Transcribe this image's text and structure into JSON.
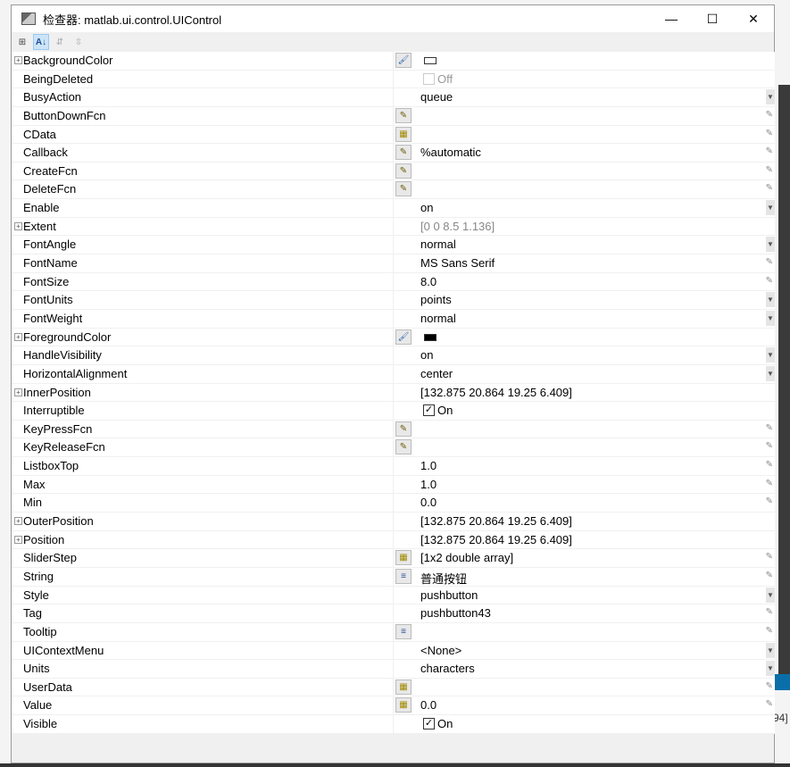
{
  "window": {
    "title": "检查器:  matlab.ui.control.UIControl",
    "minimize": "—",
    "maximize": "☐",
    "close": "✕"
  },
  "toolbar": [
    {
      "name": "categorized-view-button",
      "glyph": "⊞",
      "state": "normal"
    },
    {
      "name": "alphabetical-sort-button",
      "glyph": "A↓",
      "state": "on"
    },
    {
      "name": "expand-all-button",
      "glyph": "⇵",
      "state": "disabled"
    },
    {
      "name": "collapse-all-button",
      "glyph": "⇳",
      "state": "disabled"
    }
  ],
  "background": {
    "text": "94]"
  },
  "properties": [
    {
      "name": "BackgroundColor",
      "expand": true,
      "btn": "color",
      "kind": "swatch",
      "color": "#ffffff"
    },
    {
      "name": "BeingDeleted",
      "kind": "check",
      "checked": false,
      "disabled": true,
      "value": "Off"
    },
    {
      "name": "BusyAction",
      "kind": "text",
      "value": "queue",
      "right": "dropdown"
    },
    {
      "name": "ButtonDownFcn",
      "btn": "fcn",
      "kind": "text",
      "value": "",
      "right": "pencil"
    },
    {
      "name": "CData",
      "btn": "matrix",
      "kind": "text",
      "value": "",
      "right": "pencil"
    },
    {
      "name": "Callback",
      "btn": "fcn",
      "kind": "text",
      "value": "%automatic",
      "right": "pencil"
    },
    {
      "name": "CreateFcn",
      "btn": "fcn",
      "kind": "text",
      "value": "",
      "right": "pencil"
    },
    {
      "name": "DeleteFcn",
      "btn": "fcn",
      "kind": "text",
      "value": "",
      "right": "pencil"
    },
    {
      "name": "Enable",
      "kind": "text",
      "value": "on",
      "right": "dropdown"
    },
    {
      "name": "Extent",
      "expand": true,
      "kind": "text",
      "value": "[0 0 8.5 1.136]",
      "gray": true
    },
    {
      "name": "FontAngle",
      "kind": "text",
      "value": "normal",
      "right": "dropdown"
    },
    {
      "name": "FontName",
      "kind": "text",
      "value": "MS Sans Serif",
      "right": "pencil"
    },
    {
      "name": "FontSize",
      "kind": "text",
      "value": "8.0",
      "right": "pencil"
    },
    {
      "name": "FontUnits",
      "kind": "text",
      "value": "points",
      "right": "dropdown"
    },
    {
      "name": "FontWeight",
      "kind": "text",
      "value": "normal",
      "right": "dropdown"
    },
    {
      "name": "ForegroundColor",
      "expand": true,
      "btn": "color",
      "kind": "swatch",
      "color": "#000000"
    },
    {
      "name": "HandleVisibility",
      "kind": "text",
      "value": "on",
      "right": "dropdown"
    },
    {
      "name": "HorizontalAlignment",
      "kind": "text",
      "value": "center",
      "right": "dropdown"
    },
    {
      "name": "InnerPosition",
      "expand": true,
      "kind": "text",
      "value": "[132.875 20.864 19.25 6.409]"
    },
    {
      "name": "Interruptible",
      "kind": "check",
      "checked": true,
      "value": "On"
    },
    {
      "name": "KeyPressFcn",
      "btn": "fcn",
      "kind": "text",
      "value": "",
      "right": "pencil"
    },
    {
      "name": "KeyReleaseFcn",
      "btn": "fcn",
      "kind": "text",
      "value": "",
      "right": "pencil"
    },
    {
      "name": "ListboxTop",
      "kind": "text",
      "value": "1.0",
      "right": "pencil"
    },
    {
      "name": "Max",
      "kind": "text",
      "value": "1.0",
      "right": "pencil"
    },
    {
      "name": "Min",
      "kind": "text",
      "value": "0.0",
      "right": "pencil"
    },
    {
      "name": "OuterPosition",
      "expand": true,
      "kind": "text",
      "value": "[132.875 20.864 19.25 6.409]"
    },
    {
      "name": "Position",
      "expand": true,
      "kind": "text",
      "value": "[132.875 20.864 19.25 6.409]"
    },
    {
      "name": "SliderStep",
      "btn": "matrix",
      "kind": "text",
      "value": "[1x2  double array]",
      "right": "pencil"
    },
    {
      "name": "String",
      "btn": "textedit",
      "kind": "text",
      "value": "普通按钮",
      "right": "pencil"
    },
    {
      "name": "Style",
      "kind": "text",
      "value": "pushbutton",
      "right": "dropdown"
    },
    {
      "name": "Tag",
      "kind": "text",
      "value": "pushbutton43",
      "right": "pencil"
    },
    {
      "name": "Tooltip",
      "btn": "textedit",
      "kind": "text",
      "value": "",
      "right": "pencil"
    },
    {
      "name": "UIContextMenu",
      "kind": "text",
      "value": "<None>",
      "right": "dropdown"
    },
    {
      "name": "Units",
      "kind": "text",
      "value": "characters",
      "right": "dropdown"
    },
    {
      "name": "UserData",
      "btn": "matrix",
      "kind": "text",
      "value": "",
      "right": "pencil"
    },
    {
      "name": "Value",
      "btn": "matrix",
      "kind": "text",
      "value": "0.0",
      "right": "pencil"
    },
    {
      "name": "Visible",
      "kind": "check",
      "checked": true,
      "value": "On"
    }
  ]
}
